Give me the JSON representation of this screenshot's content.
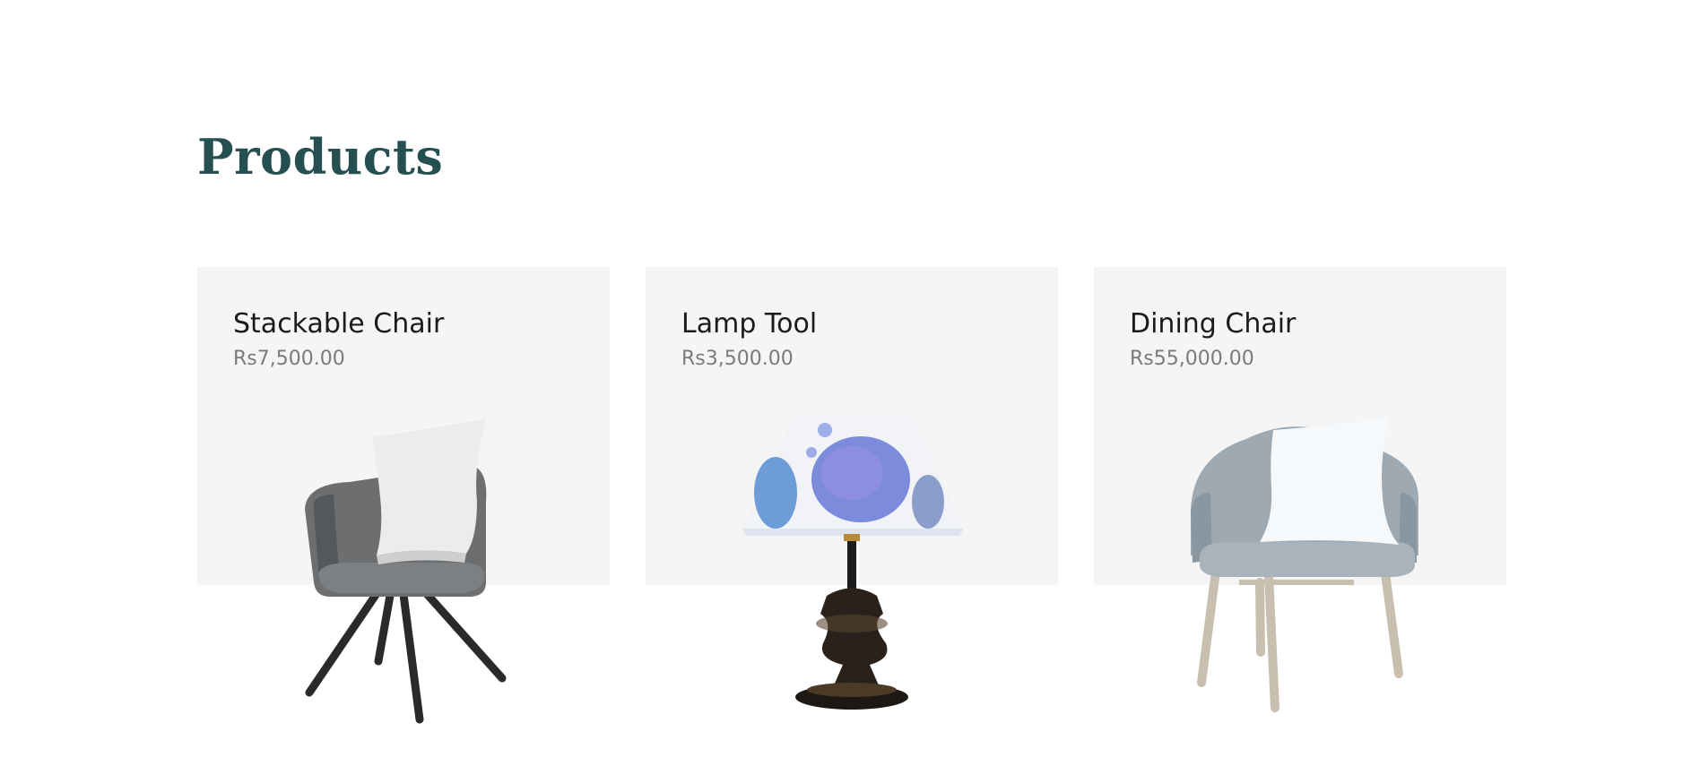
{
  "page": {
    "title": "Products"
  },
  "products": [
    {
      "name": "Stackable Chair",
      "price": "Rs7,500.00",
      "icon": "armchair-with-cushion-icon"
    },
    {
      "name": "Lamp Tool",
      "price": "Rs3,500.00",
      "icon": "table-lamp-icon"
    },
    {
      "name": "Dining Chair",
      "price": "Rs55,000.00",
      "icon": "dining-chair-with-cushion-icon"
    }
  ],
  "colors": {
    "title": "#264f52",
    "card_background": "#f4f5f4",
    "name_text": "#1b1b1b",
    "price_text": "#7b7b7b"
  }
}
